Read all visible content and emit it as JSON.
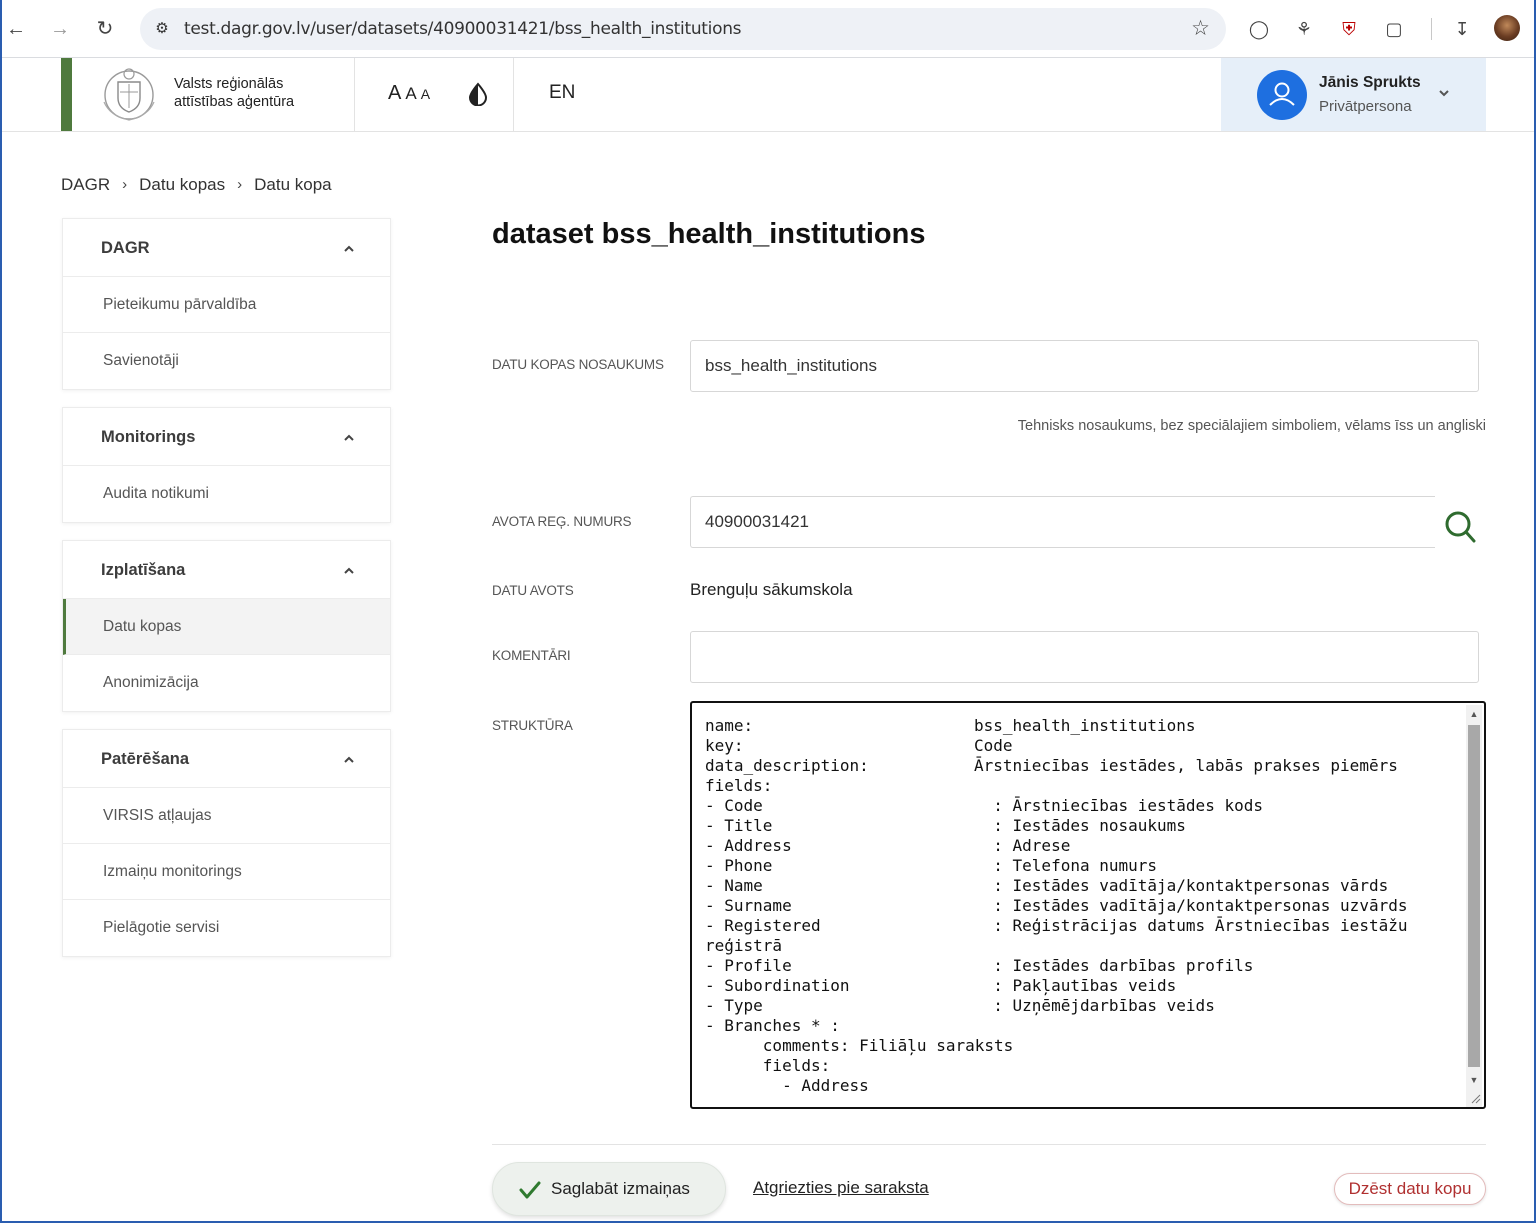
{
  "browser": {
    "url": "test.dagr.gov.lv/user/datasets/40900031421/bss_health_institutions"
  },
  "header": {
    "agency_line1": "Valsts reģionālās",
    "agency_line2": "attīstības aģentūra",
    "font_size_labels": [
      "A",
      "A",
      "A"
    ],
    "language": "EN",
    "user_name": "Jānis Sprukts",
    "user_role": "Privātpersona"
  },
  "breadcrumb": {
    "items": [
      "DAGR",
      "Datu kopas",
      "Datu kopa"
    ],
    "separator": "›"
  },
  "sidebar": {
    "sections": [
      {
        "title": "DAGR",
        "items": [
          "Pieteikumu pārvaldība",
          "Savienotāji"
        ]
      },
      {
        "title": "Monitorings",
        "items": [
          "Audita notikumi"
        ]
      },
      {
        "title": "Izplatīšana",
        "items": [
          "Datu kopas",
          "Anonimizācija"
        ],
        "active_item": "Datu kopas"
      },
      {
        "title": "Patērēšana",
        "items": [
          "VIRSIS atļaujas",
          "Izmaiņu monitorings",
          "Pielāgotie servisi"
        ]
      }
    ]
  },
  "main": {
    "title": "dataset bss_health_institutions",
    "name_label": "DATU KOPAS NOSAUKUMS",
    "name_value": "bss_health_institutions",
    "name_hint": "Tehnisks nosaukums, bez speciālajiem simboliem, vēlams īss un angliski",
    "reg_label": "AVOTA REĢ. NUMURS",
    "reg_value": "40900031421",
    "source_label": "DATU AVOTS",
    "source_value": "Brenguļu sākumskola",
    "comments_label": "KOMENTĀRI",
    "comments_value": "",
    "structure_label": "STRUKTŪRA",
    "structure_lines": [
      {
        "key": "name:",
        "value": "bss_health_institutions"
      },
      {
        "key": "key:",
        "value": "Code"
      },
      {
        "key": "data_description:",
        "value": "Ārstniecības iestādes, labās prakses piemērs"
      },
      {
        "key": "fields:",
        "value": ""
      },
      {
        "key": "- Code",
        "value": "  : Ārstniecības iestādes kods"
      },
      {
        "key": "- Title",
        "value": "  : Iestādes nosaukums"
      },
      {
        "key": "- Address",
        "value": "  : Adrese"
      },
      {
        "key": "- Phone",
        "value": "  : Telefona numurs"
      },
      {
        "key": "- Name",
        "value": "  : Iestādes vadītāja/kontaktpersonas vārds"
      },
      {
        "key": "- Surname",
        "value": "  : Iestādes vadītāja/kontaktpersonas uzvārds"
      },
      {
        "key": "- Registered",
        "value": "  : Reģistrācijas datums Ārstniecības iestāžu"
      },
      {
        "key": "reģistrā",
        "value": ""
      },
      {
        "key": "- Profile",
        "value": "  : Iestādes darbības profils"
      },
      {
        "key": "- Subordination",
        "value": "  : Pakļautības veids"
      },
      {
        "key": "- Type",
        "value": "  : Uzņēmējdarbības veids"
      },
      {
        "key": "- Branches * :",
        "value": ""
      },
      {
        "key": "      comments: Filiāļu saraksts",
        "value": ""
      },
      {
        "key": "      fields:",
        "value": ""
      },
      {
        "key": "        - Address",
        "value": ""
      }
    ]
  },
  "actions": {
    "save_label": "Saglabāt izmaiņas",
    "back_label": "Atgriezties pie saraksta",
    "delete_label": "Dzēst datu kopu"
  },
  "colors": {
    "brand_green": "#4f7a3e",
    "user_blue": "#1e6fe0",
    "delete_red": "#b03030"
  }
}
